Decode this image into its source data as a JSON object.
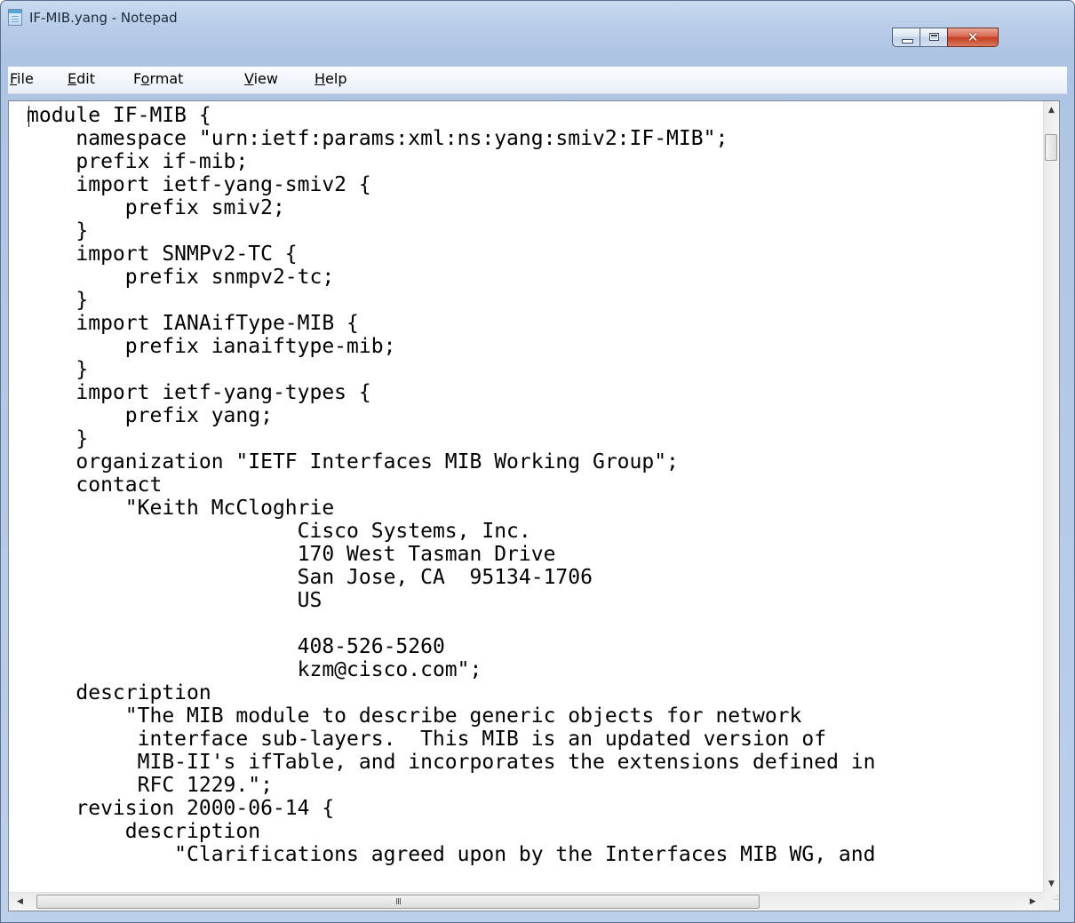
{
  "window": {
    "title": "IF-MIB.yang - Notepad",
    "close_glyph": "✕"
  },
  "menu": {
    "items": [
      {
        "label": "File",
        "u": "F",
        "rest": "ile"
      },
      {
        "label": "Edit",
        "u": "E",
        "rest": "dit"
      },
      {
        "label": "Format",
        "pre": "F",
        "u": "o",
        "rest": "rmat"
      },
      {
        "label": "View",
        "u": "V",
        "rest": "iew"
      },
      {
        "label": "Help",
        "u": "H",
        "rest": "elp"
      }
    ]
  },
  "editor": {
    "lines": [
      "module IF-MIB {",
      "    namespace \"urn:ietf:params:xml:ns:yang:smiv2:IF-MIB\";",
      "    prefix if-mib;",
      "    import ietf-yang-smiv2 {",
      "        prefix smiv2;",
      "    }",
      "    import SNMPv2-TC {",
      "        prefix snmpv2-tc;",
      "    }",
      "    import IANAifType-MIB {",
      "        prefix ianaiftype-mib;",
      "    }",
      "    import ietf-yang-types {",
      "        prefix yang;",
      "    }",
      "    organization \"IETF Interfaces MIB Working Group\";",
      "    contact",
      "        \"Keith McCloghrie",
      "                      Cisco Systems, Inc.",
      "                      170 West Tasman Drive",
      "                      San Jose, CA  95134-1706",
      "                      US",
      "",
      "                      408-526-5260",
      "                      kzm@cisco.com\";",
      "    description",
      "        \"The MIB module to describe generic objects for network",
      "         interface sub-layers.  This MIB is an updated version of",
      "         MIB-II's ifTable, and incorporates the extensions defined in",
      "         RFC 1229.\";",
      "    revision 2000-06-14 {",
      "        description",
      "            \"Clarifications agreed upon by the Interfaces MIB WG, and"
    ]
  },
  "scrollbars": {
    "vertical": {
      "up_arrow": "▲",
      "down_arrow": "▼"
    },
    "horizontal": {
      "left_arrow": "◀",
      "right_arrow": "▶",
      "grip": "III"
    },
    "size_grip": ".:"
  }
}
